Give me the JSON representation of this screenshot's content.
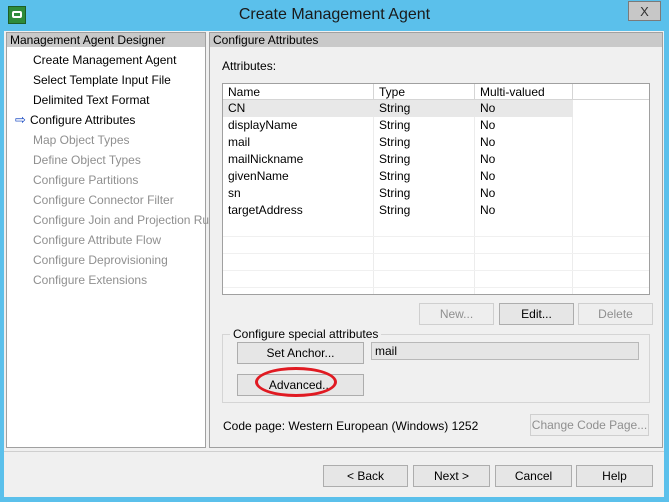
{
  "window": {
    "title": "Create Management Agent",
    "close_label": "X"
  },
  "left_pane": {
    "header": "Management Agent Designer",
    "steps": [
      {
        "label": "Create Management Agent",
        "state": "done"
      },
      {
        "label": "Select Template Input File",
        "state": "done"
      },
      {
        "label": "Delimited Text Format",
        "state": "done"
      },
      {
        "label": "Configure Attributes",
        "state": "current"
      },
      {
        "label": "Map Object Types",
        "state": "future"
      },
      {
        "label": "Define Object Types",
        "state": "future"
      },
      {
        "label": "Configure Partitions",
        "state": "future"
      },
      {
        "label": "Configure Connector Filter",
        "state": "future"
      },
      {
        "label": "Configure Join and Projection Rules",
        "state": "future"
      },
      {
        "label": "Configure Attribute Flow",
        "state": "future"
      },
      {
        "label": "Configure Deprovisioning",
        "state": "future"
      },
      {
        "label": "Configure Extensions",
        "state": "future"
      }
    ],
    "current_arrow": "⇨"
  },
  "right_pane": {
    "header": "Configure Attributes",
    "attributes_label": "Attributes:",
    "columns": [
      "Name",
      "Type",
      "Multi-valued"
    ],
    "rows": [
      {
        "name": "CN",
        "type": "String",
        "multi": "No"
      },
      {
        "name": "displayName",
        "type": "String",
        "multi": "No"
      },
      {
        "name": "mail",
        "type": "String",
        "multi": "No"
      },
      {
        "name": "mailNickname",
        "type": "String",
        "multi": "No"
      },
      {
        "name": "givenName",
        "type": "String",
        "multi": "No"
      },
      {
        "name": "sn",
        "type": "String",
        "multi": "No"
      },
      {
        "name": "targetAddress",
        "type": "String",
        "multi": "No"
      }
    ],
    "new_label": "New...",
    "edit_label": "Edit...",
    "delete_label": "Delete",
    "special_group_title": "Configure special attributes",
    "set_anchor_label": "Set Anchor...",
    "anchor_value": "mail",
    "advanced_label": "Advanced...",
    "code_page_text": "Code page: Western European (Windows) 1252",
    "change_code_page_label": "Change Code Page..."
  },
  "footer": {
    "back_label": "< Back",
    "next_label": "Next >",
    "cancel_label": "Cancel",
    "help_label": "Help"
  },
  "colors": {
    "titlebar": "#5bc0eb",
    "highlight_ring": "#e01a22",
    "arrow": "#0a3fbf"
  }
}
